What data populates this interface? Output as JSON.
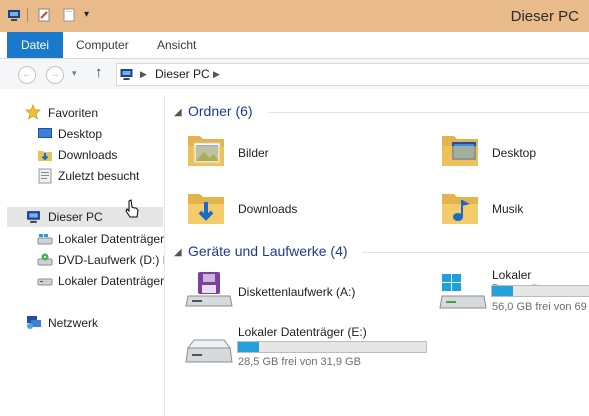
{
  "window": {
    "title": "Dieser PC"
  },
  "ribbon": {
    "tabs": [
      "Datei",
      "Computer",
      "Ansicht"
    ]
  },
  "address": {
    "segments": [
      "Dieser PC"
    ]
  },
  "nav": {
    "favorites_label": "Favoriten",
    "favorites": [
      "Desktop",
      "Downloads",
      "Zuletzt besucht"
    ],
    "this_pc": "Dieser PC",
    "drives": [
      "Lokaler Datenträger",
      "DVD-Laufwerk (D:) II",
      "Lokaler Datenträger"
    ],
    "network": "Netzwerk"
  },
  "content": {
    "folders_header": "Ordner (6)",
    "folders": [
      "Bilder",
      "Desktop",
      "Downloads",
      "Musik"
    ],
    "devices_header": "Geräte und Laufwerke (4)",
    "devices": [
      {
        "name": "Diskettenlaufwerk (A:)"
      },
      {
        "name": "Lokaler Datenträger",
        "free_text": "56,0 GB frei von 69",
        "used_fraction": 0.19
      },
      {
        "name": "Lokaler Datenträger (E:)",
        "free_text": "28,5 GB frei von 31,9 GB",
        "used_fraction": 0.11
      }
    ]
  },
  "colors": {
    "accent": "#1979ca",
    "titlebar": "#e9ba8a",
    "bar": "#26a0da",
    "header": "#1e3a8c"
  }
}
